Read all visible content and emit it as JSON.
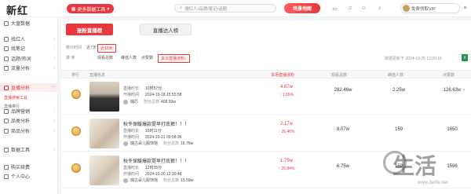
{
  "app": {
    "logo_text": "新红"
  },
  "header": {
    "tools_label": "更多数据工具",
    "search_placeholder": "搜红人/品牌/笔记/话题",
    "scene_label": "场景地图",
    "vip_label": "免费领取VIP",
    "brand_color": "#e8383d"
  },
  "sidebar": {
    "items": [
      {
        "label": "大盘数据",
        "active": false
      },
      {
        "label": "找红人",
        "active": false
      },
      {
        "label": "找笔记",
        "active": false
      },
      {
        "label": "话题/热词",
        "active": false
      },
      {
        "label": "流量分析",
        "active": false
      },
      {
        "label": "直播分析",
        "active": true
      },
      {
        "label": "品牌营销",
        "active": false
      },
      {
        "label": "品类分析",
        "active": false
      },
      {
        "label": "商品分析",
        "active": false
      },
      {
        "label": "数据工具",
        "active": false
      },
      {
        "label": "购买续费",
        "active": false
      },
      {
        "label": "个人中心",
        "active": false
      }
    ],
    "sub_items": [
      {
        "label": "直播搜索工具",
        "active": true
      },
      {
        "label": "直播排行",
        "active": false
      }
    ]
  },
  "main": {
    "tabs": [
      {
        "label": "涨粉直播榜",
        "active": true
      },
      {
        "label": "直播达人榜",
        "active": false
      }
    ],
    "filters": {
      "period_label": "统计时间",
      "periods": [
        {
          "label": "近7天",
          "selected": false
        },
        {
          "label": "近15天",
          "selected": true
        }
      ],
      "sort_label": "排 序",
      "sorts": [
        {
          "label": "观看总数",
          "selected": false
        },
        {
          "label": "峰值人数",
          "selected": false
        },
        {
          "label": "点赞数",
          "selected": false
        },
        {
          "label": "本次直播涨粉↓",
          "selected": true
        }
      ]
    },
    "update_time": "数据更新于 2024-10-25 12:00:16",
    "export_icon": "excel-icon",
    "table": {
      "headers": [
        "排行",
        "直播信息",
        "本场直播涨粉",
        "观看总数",
        "峰值人数",
        "点赞数"
      ],
      "rows": [
        {
          "title": "",
          "duration_label": "直播时长",
          "duration": "10时57分",
          "start_label": "开播时间",
          "start": "2024-10-18 15:55:58",
          "anchor": "璐芯",
          "fans_label": "粉丝总数",
          "fans": "408.93w",
          "growth": "4.67w",
          "growth_pct": "1.65%",
          "views": "282.46w",
          "peak": "2.25w",
          "likes": "126.63w"
        },
        {
          "title": "秋冬保暖爆款提早打底裤！！！",
          "duration_label": "直播时长",
          "duration": "15时11分",
          "start_label": "开播时间",
          "start": "2024-10-21 09:58:36",
          "anchor": "璐古朵儿服饰馆",
          "fans_label": "粉丝总数",
          "fans": "15.76w",
          "growth": "2.17w",
          "growth_pct": "26.46%",
          "views": "8.07w",
          "peak": "159",
          "likes": "1650"
        },
        {
          "title": "秋冬保暖爆款提早打底裤！！！",
          "duration_label": "直播时长",
          "duration": "12时35分",
          "start_label": "开播时间",
          "start": "2024-10-20 12:30:48",
          "anchor": "璐古朵儿服饰馆",
          "fans_label": "粉丝总数",
          "fans": "13.59w",
          "growth": "1.79w",
          "growth_pct": "26.84%",
          "views": "6.75w",
          "peak": "159",
          "likes": "1596"
        }
      ]
    }
  },
  "watermark": {
    "text": "生活",
    "site": "www.3elife.net"
  }
}
